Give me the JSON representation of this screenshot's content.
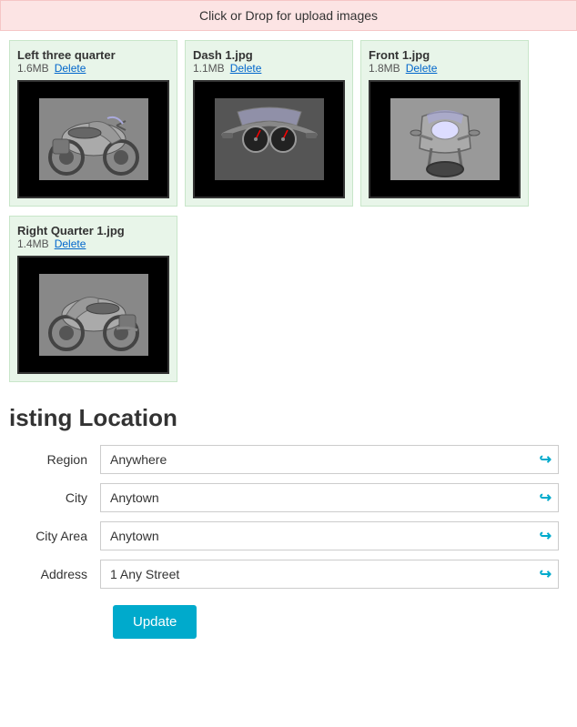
{
  "upload": {
    "banner_label": "Click or Drop for upload images"
  },
  "images": [
    {
      "title": "Left three quarter",
      "size": "1.6MB",
      "delete_label": "Delete",
      "view": "left-three-quarter"
    },
    {
      "title": "Dash 1.jpg",
      "size": "1.1MB",
      "delete_label": "Delete",
      "view": "dash"
    },
    {
      "title": "Front 1.jpg",
      "size": "1.8MB",
      "delete_label": "Delete",
      "view": "front"
    },
    {
      "title": "Right Quarter 1.jpg",
      "size": "1.4MB",
      "delete_label": "Delete",
      "view": "right-quarter"
    }
  ],
  "section": {
    "title": "isting Location"
  },
  "form": {
    "region_label": "Region",
    "region_value": "Anywhere",
    "city_label": "City",
    "city_value": "Anytown",
    "city_area_label": "City Area",
    "city_area_value": "Anytown",
    "address_label": "Address",
    "address_value": "1 Any Street",
    "update_label": "Update"
  }
}
